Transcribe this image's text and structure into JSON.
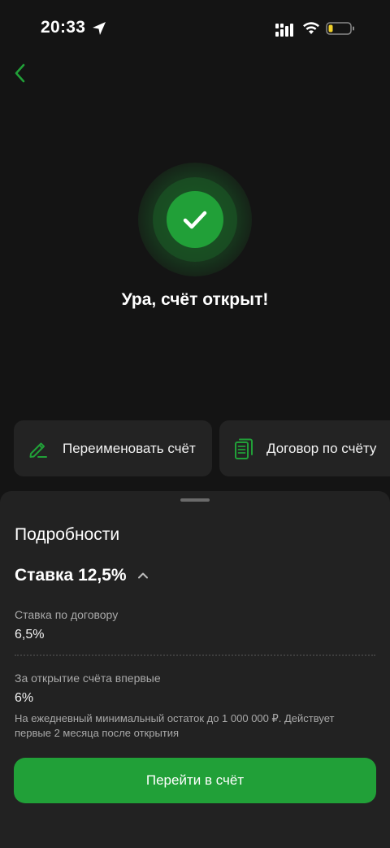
{
  "status_bar": {
    "time": "20:33",
    "icons": [
      "location-arrow-icon",
      "cellular-signal-icon",
      "wifi-icon",
      "battery-low-icon"
    ]
  },
  "nav": {
    "back_icon": "chevron-left-icon"
  },
  "success": {
    "icon": "checkmark-icon",
    "title": "Ура, счёт открыт!"
  },
  "actions": [
    {
      "label": "Переименовать счёт",
      "icon": "pencil-icon"
    },
    {
      "label": "Договор по счёту",
      "icon": "documents-icon"
    }
  ],
  "details": {
    "title": "Подробности",
    "rate_title": "Ставка 12,5%",
    "contract_rate_label": "Ставка по договору",
    "contract_rate_value": "6,5%",
    "first_open_label": "За открытие счёта впервые",
    "first_open_value": "6%",
    "note": "На ежедневный минимальный остаток до 1 000 000 ₽. Действует первые 2 месяца после открытия"
  },
  "primary_button": {
    "label": "Перейти в счёт"
  },
  "colors": {
    "accent": "#21a038",
    "background": "#141414",
    "card": "#232323",
    "sheet": "#222222",
    "secondary_text": "#a8a8a8",
    "battery_level": "#f0d02a"
  }
}
